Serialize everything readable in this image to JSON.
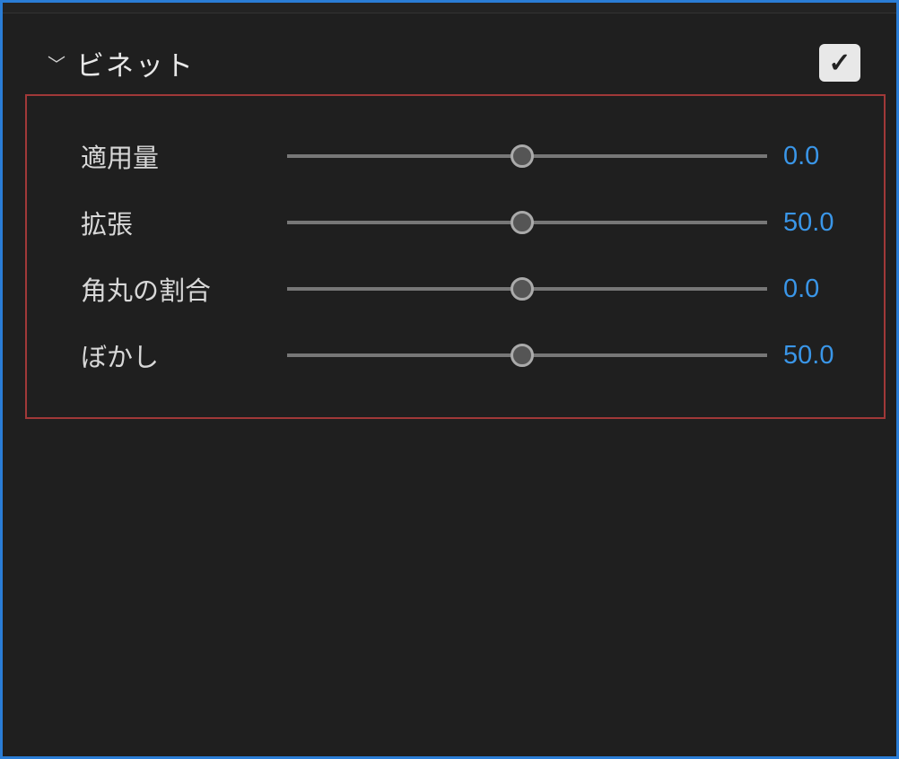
{
  "section": {
    "title": "ビネット",
    "expanded": true,
    "enabled": true
  },
  "sliders": [
    {
      "label": "適用量",
      "value": "0.0",
      "position": 50
    },
    {
      "label": "拡張",
      "value": "50.0",
      "position": 50
    },
    {
      "label": "角丸の割合",
      "value": "0.0",
      "position": 50
    },
    {
      "label": "ぼかし",
      "value": "50.0",
      "position": 50
    }
  ],
  "colors": {
    "accent": "#3a96e8",
    "border_highlight": "#2a7dd6",
    "selection_border": "#a03838"
  }
}
